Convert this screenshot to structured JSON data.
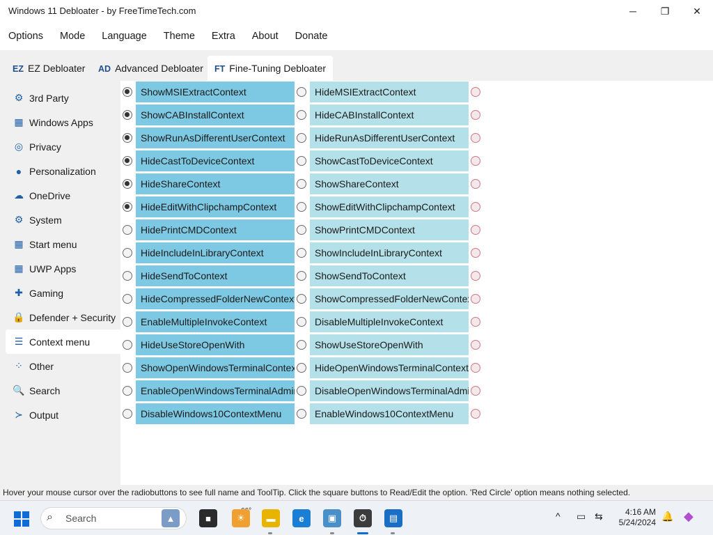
{
  "window": {
    "title": "Windows 11 Debloater - by FreeTimeTech.com",
    "minimize_glyph": "─",
    "maximize_glyph": "❐",
    "close_glyph": "✕"
  },
  "menu": [
    "Options",
    "Mode",
    "Language",
    "Theme",
    "Extra",
    "About",
    "Donate"
  ],
  "tabs": [
    {
      "abbr": "EZ",
      "label": "EZ Debloater",
      "active": false
    },
    {
      "abbr": "AD",
      "label": "Advanced Debloater",
      "active": false
    },
    {
      "abbr": "FT",
      "label": "Fine-Tuning Debloater",
      "active": true
    }
  ],
  "sidebar": [
    {
      "label": "3rd Party",
      "icon": "puzzle-icon",
      "glyph": "⚙"
    },
    {
      "label": "Windows Apps",
      "icon": "windows-apps-icon",
      "glyph": "▦"
    },
    {
      "label": "Privacy",
      "icon": "fingerprint-icon",
      "glyph": "◎"
    },
    {
      "label": "Personalization",
      "icon": "user-icon",
      "glyph": "●"
    },
    {
      "label": "OneDrive",
      "icon": "cloud-icon",
      "glyph": "☁"
    },
    {
      "label": "System",
      "icon": "gear-icon",
      "glyph": "⚙"
    },
    {
      "label": "Start menu",
      "icon": "windows-logo-icon",
      "glyph": "▦"
    },
    {
      "label": "UWP Apps",
      "icon": "apps-icon",
      "glyph": "▦"
    },
    {
      "label": "Gaming",
      "icon": "gamepad-icon",
      "glyph": "✚"
    },
    {
      "label": "Defender + Security",
      "icon": "lock-icon",
      "glyph": "🔒"
    },
    {
      "label": "Context menu",
      "icon": "list-icon",
      "glyph": "☰",
      "active": true
    },
    {
      "label": "Other",
      "icon": "grid-dots-icon",
      "glyph": "⁘"
    },
    {
      "label": "Search",
      "icon": "search-icon",
      "glyph": "🔍"
    },
    {
      "label": "Output",
      "icon": "terminal-icon",
      "glyph": "≻"
    }
  ],
  "options": [
    {
      "left": "ShowMSIExtractContext",
      "right": "HideMSIExtractContext",
      "selected": "left"
    },
    {
      "left": "ShowCABInstallContext",
      "right": "HideCABInstallContext",
      "selected": "left"
    },
    {
      "left": "ShowRunAsDifferentUserContext",
      "right": "HideRunAsDifferentUserContext",
      "selected": "left"
    },
    {
      "left": "HideCastToDeviceContext",
      "right": "ShowCastToDeviceContext",
      "selected": "left"
    },
    {
      "left": "HideShareContext",
      "right": "ShowShareContext",
      "selected": "left"
    },
    {
      "left": "HideEditWithClipchampContext",
      "right": "ShowEditWithClipchampContext",
      "selected": "left"
    },
    {
      "left": "HidePrintCMDContext",
      "right": "ShowPrintCMDContext",
      "selected": "none"
    },
    {
      "left": "HideIncludeInLibraryContext",
      "right": "ShowIncludeInLibraryContext",
      "selected": "none"
    },
    {
      "left": "HideSendToContext",
      "right": "ShowSendToContext",
      "selected": "none"
    },
    {
      "left": "HideCompressedFolderNewContext",
      "right": "ShowCompressedFolderNewContext",
      "selected": "none"
    },
    {
      "left": "EnableMultipleInvokeContext",
      "right": "DisableMultipleInvokeContext",
      "selected": "none"
    },
    {
      "left": "HideUseStoreOpenWith",
      "right": "ShowUseStoreOpenWith",
      "selected": "none"
    },
    {
      "left": "ShowOpenWindowsTerminalContext",
      "right": "HideOpenWindowsTerminalContext",
      "selected": "none"
    },
    {
      "left": "EnableOpenWindowsTerminalAdminContext",
      "right": "DisableOpenWindowsTerminalAdminContext",
      "selected": "none"
    },
    {
      "left": "DisableWindows10ContextMenu",
      "right": "EnableWindows10ContextMenu",
      "selected": "none"
    }
  ],
  "status_text": "Hover your mouse cursor over the radiobuttons to see full name and ToolTip. Click the square buttons to Read/Edit the option. 'Red Circle' option means nothing selected.",
  "colors": {
    "left_cell": "#7dc9e3",
    "right_cell": "#b4e1e9",
    "accent": "#0f6cd4"
  },
  "taskbar": {
    "search_placeholder": "Search",
    "weather_temp": "66°",
    "apps": [
      {
        "name": "landscape-widget-icon",
        "glyph": "▲"
      },
      {
        "name": "task-view-icon",
        "glyph": "■"
      },
      {
        "name": "weather-icon",
        "glyph": "☀"
      },
      {
        "name": "file-explorer-icon",
        "glyph": "▬"
      },
      {
        "name": "edge-icon",
        "glyph": "e"
      },
      {
        "name": "control-panel-icon",
        "glyph": "▣"
      },
      {
        "name": "stopwatch-icon",
        "glyph": "⏱"
      },
      {
        "name": "debloater-app-icon",
        "glyph": "▤"
      }
    ],
    "tray": {
      "chevron": "^",
      "time": "4:16 AM",
      "date": "5/24/2024"
    }
  }
}
